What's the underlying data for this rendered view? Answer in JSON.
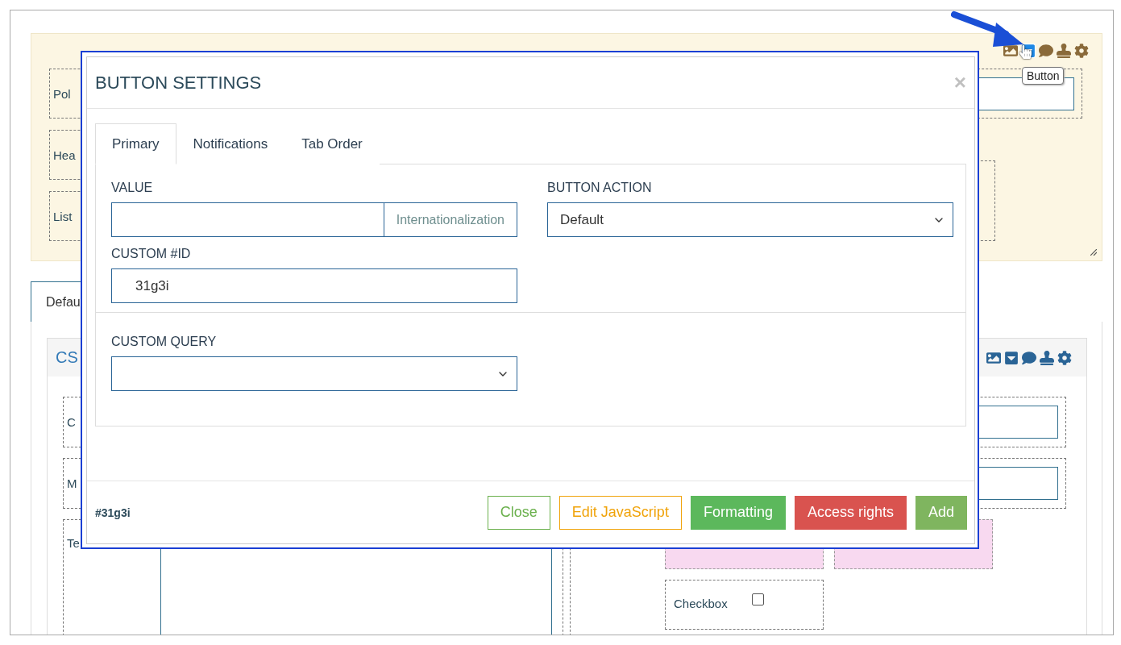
{
  "designer": {
    "toolbar": [
      {
        "kind": "image",
        "selected": false
      },
      {
        "kind": "button",
        "selected": true
      },
      {
        "kind": "comment",
        "selected": false
      },
      {
        "kind": "stamp",
        "selected": false
      },
      {
        "kind": "settings",
        "selected": false
      }
    ],
    "tooltip": "Button",
    "top_fields": [
      {
        "label": "Pol"
      },
      {
        "label": "Hea"
      },
      {
        "label": "List"
      }
    ],
    "tabs": [
      {
        "label": "Defau",
        "selected": true
      }
    ],
    "card": {
      "title": "CS",
      "fields": [
        {
          "label": "C"
        },
        {
          "label": "M"
        },
        {
          "label": "Te"
        }
      ],
      "checkbox": {
        "label": "Checkbox",
        "checked": false
      }
    }
  },
  "dialog": {
    "title": "BUTTON SETTINGS",
    "close": "×",
    "tabs": [
      {
        "label": "Primary",
        "selected": true
      },
      {
        "label": "Notifications",
        "selected": false
      },
      {
        "label": "Tab Order",
        "selected": false
      }
    ],
    "value": {
      "label": "VALUE",
      "addon": "Internationalization"
    },
    "button_action": {
      "label": "BUTTON ACTION",
      "value": "Default"
    },
    "custom_id": {
      "label": "CUSTOM #ID",
      "value": "31g3i"
    },
    "custom_query": {
      "label": "CUSTOM QUERY"
    },
    "footer_id": "#31g3i",
    "buttons": [
      {
        "label": "Close",
        "kind": "outline",
        "color": "#6ab04c"
      },
      {
        "label": "Edit JavaScript",
        "kind": "outline",
        "color": "#f0a30a"
      },
      {
        "label": "Formatting",
        "kind": "solid",
        "color": "#5cb85c"
      },
      {
        "label": "Access rights",
        "kind": "solid",
        "color": "#d9534f"
      },
      {
        "label": "Add",
        "kind": "solid",
        "color": "#7fb55f"
      }
    ]
  }
}
